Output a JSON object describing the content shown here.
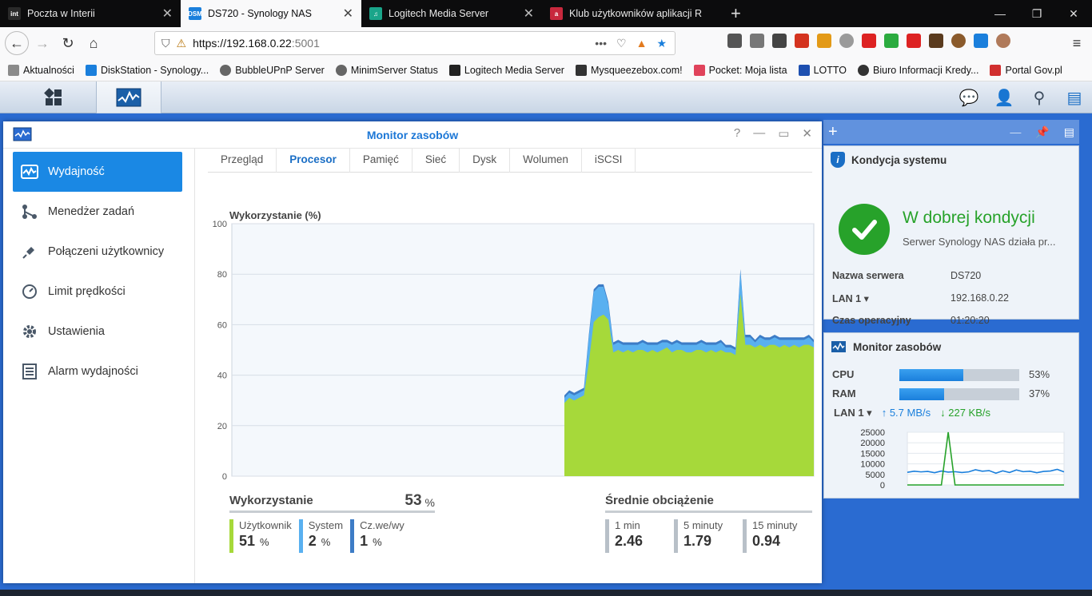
{
  "browser": {
    "tabs": [
      {
        "title": "Poczta w Interii",
        "icon_text": "int",
        "color": "#2a2a2a"
      },
      {
        "title": "DS720 - Synology NAS",
        "icon_text": "DSM",
        "color": "#1a7fdc"
      },
      {
        "title": "Logitech Media Server",
        "icon_text": "♫",
        "color": "#1aa58a"
      },
      {
        "title": "Klub użytkowników aplikacji R",
        "icon_text": "a",
        "color": "#c8283d"
      }
    ],
    "url_host": "https://192.168.0.22",
    "url_port": ":5001",
    "bookmarks": [
      {
        "label": "Aktualności",
        "color": "#8a8a8a"
      },
      {
        "label": "DiskStation - Synology...",
        "color": "#1a7fdc"
      },
      {
        "label": "BubbleUPnP Server",
        "color": "#666"
      },
      {
        "label": "MinimServer Status",
        "color": "#666"
      },
      {
        "label": "Logitech Media Server",
        "color": "#222"
      },
      {
        "label": "Mysqueezebox.com!",
        "color": "#333"
      },
      {
        "label": "Pocket: Moja lista",
        "color": "#e0435b"
      },
      {
        "label": "LOTTO",
        "color": "#1d4fb0"
      },
      {
        "label": "Biuro Informacji Kredy...",
        "color": "#333"
      },
      {
        "label": "Portal Gov.pl",
        "color": "#d12f2f"
      }
    ]
  },
  "window": {
    "title": "Monitor zasobów",
    "sidebar": [
      {
        "label": "Wydajność",
        "icon": "performance-icon"
      },
      {
        "label": "Menedżer zadań",
        "icon": "task-manager-icon"
      },
      {
        "label": "Połączeni użytkownicy",
        "icon": "plug-icon"
      },
      {
        "label": "Limit prędkości",
        "icon": "speedometer-icon"
      },
      {
        "label": "Ustawienia",
        "icon": "gear-icon"
      },
      {
        "label": "Alarm wydajności",
        "icon": "list-icon"
      }
    ],
    "tabs": [
      "Przegląd",
      "Procesor",
      "Pamięć",
      "Sieć",
      "Dysk",
      "Wolumen",
      "iSCSI"
    ],
    "active_tab": "Procesor",
    "chart_title": "Wykorzystanie (%)",
    "usage": {
      "label": "Wykorzystanie",
      "value": "53",
      "unit": "%",
      "items": [
        {
          "label": "Użytkownik",
          "value": "51",
          "unit": "%",
          "color": "#a6d93a"
        },
        {
          "label": "System",
          "value": "2",
          "unit": "%",
          "color": "#59b0f0"
        },
        {
          "label": "Cz.we/wy",
          "value": "1",
          "unit": "%",
          "color": "#3d7cc6"
        }
      ]
    },
    "load": {
      "label": "Średnie obciążenie",
      "items": [
        {
          "label": "1 min",
          "value": "2.46"
        },
        {
          "label": "5 minuty",
          "value": "1.79"
        },
        {
          "label": "15 minuty",
          "value": "0.94"
        }
      ]
    }
  },
  "chart_data": [
    {
      "type": "area",
      "title": "Wykorzystanie (%)",
      "ylim": [
        0,
        100
      ],
      "yticks": [
        0,
        20,
        40,
        60,
        80,
        100
      ],
      "grid": true,
      "x_count": 120,
      "series": [
        {
          "name": "Użytkownik",
          "color": "#a6d93a",
          "start_index": 68,
          "values": [
            29,
            31,
            30,
            31,
            32,
            45,
            61,
            63,
            64,
            62,
            49,
            50,
            49,
            50,
            49,
            50,
            50,
            49,
            50,
            49,
            50,
            51,
            49,
            50,
            50,
            49,
            49,
            50,
            50,
            49,
            50,
            49,
            50,
            49,
            49,
            48,
            72,
            52,
            52,
            51,
            52,
            51,
            52,
            52,
            51,
            52,
            51,
            52,
            51,
            52,
            52,
            51
          ]
        },
        {
          "name": "System",
          "color": "#59b0f0",
          "start_index": 68,
          "values": [
            2,
            2,
            2,
            2,
            2,
            10,
            12,
            12,
            11,
            6,
            3,
            3,
            3,
            2,
            3,
            2,
            3,
            3,
            2,
            3,
            3,
            2,
            3,
            3,
            2,
            3,
            3,
            2,
            3,
            3,
            2,
            3,
            3,
            2,
            2,
            2,
            9,
            3,
            3,
            2,
            3,
            3,
            2,
            3,
            3,
            2,
            3,
            2,
            3,
            2,
            3,
            2
          ]
        },
        {
          "name": "Cz.we/wy",
          "color": "#3d7cc6",
          "start_index": 68,
          "values": [
            1,
            1,
            1,
            1,
            1,
            1,
            1,
            1,
            1,
            1,
            1,
            1,
            1,
            1,
            1,
            1,
            1,
            1,
            1,
            1,
            1,
            1,
            1,
            1,
            1,
            1,
            1,
            1,
            1,
            1,
            1,
            1,
            1,
            1,
            1,
            1,
            1,
            1,
            1,
            1,
            1,
            1,
            1,
            1,
            1,
            1,
            1,
            1,
            1,
            1,
            1,
            1
          ]
        }
      ]
    },
    {
      "type": "line",
      "ylim": [
        0,
        25000
      ],
      "yticks": [
        0,
        5000,
        10000,
        15000,
        20000,
        25000
      ],
      "grid": true,
      "series": [
        {
          "name": "upload",
          "color": "#1a7fdc",
          "values": [
            6000,
            6500,
            6200,
            6400,
            5800,
            6600,
            6100,
            6300,
            5900,
            6200,
            7200,
            6500,
            6800,
            5600,
            6700,
            5900,
            7100,
            6300,
            6500,
            5800,
            6400,
            6600,
            7400,
            6200
          ]
        },
        {
          "name": "download",
          "color": "#27a22a",
          "values": [
            0,
            0,
            0,
            0,
            0,
            0,
            26000,
            0,
            0,
            0,
            0,
            0,
            0,
            0,
            0,
            0,
            0,
            0,
            0,
            0,
            0,
            0,
            0,
            0
          ]
        }
      ]
    }
  ],
  "widgets": {
    "health": {
      "title": "Kondycja systemu",
      "status": "W dobrej kondycji",
      "message": "Serwer Synology NAS działa pr...",
      "rows": [
        {
          "key": "Nazwa serwera",
          "value": "DS720"
        },
        {
          "key": "LAN 1 ▾",
          "value": "192.168.0.22"
        },
        {
          "key": "Czas operacyjny",
          "value": "01:20:20"
        }
      ]
    },
    "monitor": {
      "title": "Monitor zasobów",
      "cpu_label": "CPU",
      "cpu_pct": 53,
      "cpu_text": "53%",
      "ram_label": "RAM",
      "ram_pct": 37,
      "ram_text": "37%",
      "lan_label": "LAN 1 ▾",
      "up": "↑ 5.7 MB/s",
      "down": "↓ 227 KB/s"
    }
  }
}
